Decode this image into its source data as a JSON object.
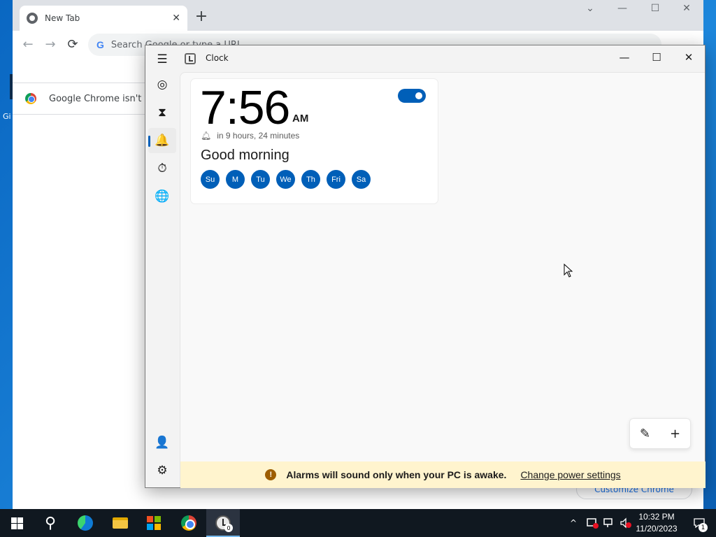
{
  "chrome": {
    "tab_title": "New Tab",
    "tab_close": "✕",
    "new_tab": "+",
    "win_controls": [
      "⌄",
      "—",
      "☐",
      "✕"
    ],
    "nav": {
      "back": "←",
      "forward": "→",
      "reload": "⟳"
    },
    "omnibox_placeholder": "Search Google or type a URL",
    "google_g": "G",
    "infobar_text": "Google Chrome isn't your default browser",
    "customize_label": "Customize Chrome"
  },
  "desktop": {
    "icon_label": "Gi"
  },
  "clock_app": {
    "title": "Clock",
    "caption": {
      "minimize": "—",
      "maximize": "☐",
      "close": "✕"
    },
    "rail": {
      "menu": "☰",
      "focus": "◎",
      "timer": "⧗",
      "alarm": "🔔",
      "stopwatch": "⏱",
      "world_clock": "🌐",
      "account": "👤",
      "settings": "⚙"
    },
    "alarm": {
      "time": "7:56",
      "ampm": "AM",
      "enabled": true,
      "remaining": "in 9 hours, 24 minutes",
      "name": "Good morning",
      "days": [
        "Su",
        "M",
        "Tu",
        "We",
        "Th",
        "Fri",
        "Sa"
      ]
    },
    "actions": {
      "edit": "✎",
      "add": "+"
    },
    "banner": {
      "icon": "!",
      "message": "Alarms will sound only when your PC is awake.",
      "link": "Change power settings"
    }
  },
  "taskbar": {
    "search_icon": "⚲",
    "clock_badge": "0",
    "tray": {
      "chevron": "^",
      "time": "10:32 PM",
      "date": "11/20/2023",
      "notifications": "1"
    }
  },
  "colors": {
    "accent": "#005fb8",
    "banner": "#fff4ce",
    "taskbar": "#101820"
  }
}
